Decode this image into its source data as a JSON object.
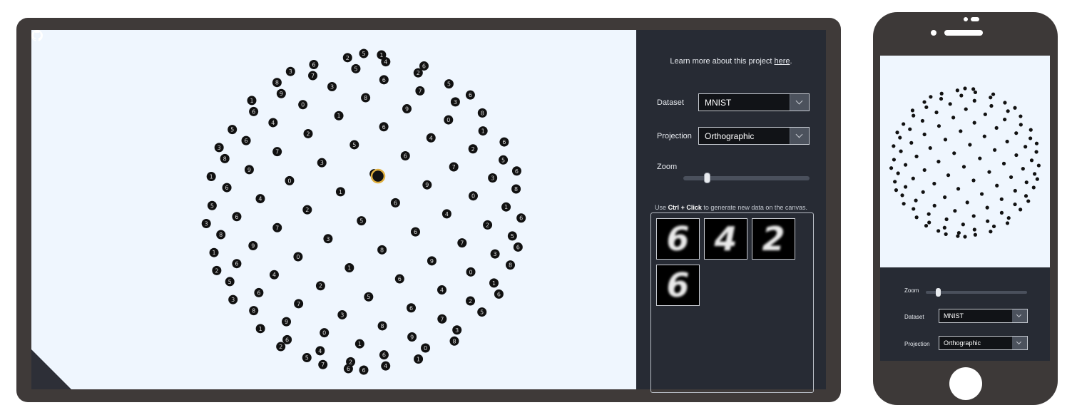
{
  "desktop": {
    "learn_prefix": "Learn more about this project ",
    "learn_link": "here",
    "learn_suffix": ".",
    "dataset_label": "Dataset",
    "dataset_value": "MNIST",
    "projection_label": "Projection",
    "projection_value": "Orthographic",
    "zoom_label": "Zoom",
    "zoom_level": 0.17,
    "hint_prefix": "Use ",
    "hint_keys": "Ctrl + Click",
    "hint_suffix": " to generate new data on the canvas.",
    "generated_digits": [
      "6",
      "4",
      "2",
      "6"
    ],
    "canvas_digits_sample": [
      "6",
      "6",
      "9",
      "4",
      "7",
      "0",
      "2",
      "3",
      "1",
      "5",
      "8"
    ],
    "colors": {
      "frame": "#3f3a39",
      "canvas": "#eff6fe",
      "panel": "#272b34",
      "point": "#111111",
      "highlight": "#e0b040"
    },
    "icons": {
      "corner": "github-icon",
      "dropdown": "chevron-down-icon"
    }
  },
  "phone": {
    "zoom_label": "Zoom",
    "zoom_level": 0.1,
    "dataset_label": "Dataset",
    "dataset_value": "MNIST",
    "projection_label": "Projection",
    "projection_value": "Orthographic"
  }
}
